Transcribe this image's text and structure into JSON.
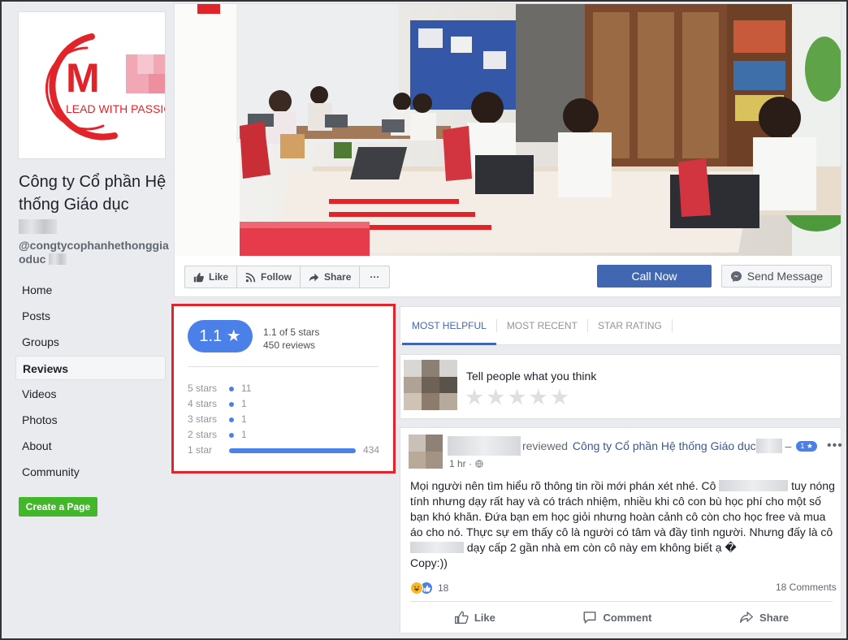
{
  "brand": {
    "logo_letter": "M",
    "logo_tagline": "LEAD WITH PASSIO",
    "accent_red": "#e0242a",
    "link_blue": "#4267b2",
    "rating_blue": "#4a80e8"
  },
  "page": {
    "name": "Công ty Cổ phần Hệ thống Giáo dục",
    "handle": "@congtycophanhethonggiaoduc"
  },
  "nav": [
    {
      "label": "Home",
      "active": false
    },
    {
      "label": "Posts",
      "active": false
    },
    {
      "label": "Groups",
      "active": false
    },
    {
      "label": "Reviews",
      "active": true
    },
    {
      "label": "Videos",
      "active": false
    },
    {
      "label": "Photos",
      "active": false
    },
    {
      "label": "About",
      "active": false
    },
    {
      "label": "Community",
      "active": false
    }
  ],
  "create_page_label": "Create a Page",
  "actions": {
    "like": "Like",
    "follow": "Follow",
    "share": "Share",
    "more": "···",
    "call_now": "Call Now",
    "send_message": "Send Message"
  },
  "rating": {
    "score_label": "1.1 ★",
    "summary": "1.1 of 5 stars",
    "reviews_count": "450 reviews",
    "distribution": [
      {
        "label": "5 stars",
        "count": "11",
        "fraction": 0.025
      },
      {
        "label": "4 stars",
        "count": "1",
        "fraction": 0.002
      },
      {
        "label": "3 stars",
        "count": "1",
        "fraction": 0.002
      },
      {
        "label": "2 stars",
        "count": "1",
        "fraction": 0.002
      },
      {
        "label": "1 star",
        "count": "434",
        "fraction": 1.0
      }
    ]
  },
  "tabs": [
    {
      "label": "MOST HELPFUL",
      "active": true
    },
    {
      "label": "MOST RECENT",
      "active": false
    },
    {
      "label": "STAR RATING",
      "active": false
    }
  ],
  "composer": {
    "prompt": "Tell people what you think",
    "star_glyph": "★"
  },
  "review": {
    "action_text": "reviewed",
    "page_name": "Công ty Cổ phần Hệ thống Giáo dục",
    "dash": "–",
    "star_badge": "1 ★",
    "time": "1 hr ·",
    "body": {
      "l1": "Mọi người nên tìm hiểu rõ thông tin rồi mới phán xét nhé. Cô",
      "l1b": "tuy nóng",
      "l2": "tính nhưng dạy rất hay và có trách nhiệm, nhiều khi cô con bù học phí cho một số",
      "l3": "bạn khó khăn. Đứa bạn em học giỏi nhưng hoàn cảnh cô còn cho học free và mua",
      "l4": "áo cho nó. Thực sự em thấy cô là người có tâm và đầy tình người. Nhưng đấy là cô",
      "l5": "dạy cấp 2 gần nhà em còn cô này em không biết ạ �",
      "l6": "Copy:))"
    },
    "reactions_count": "18",
    "comments_count": "18 Comments",
    "like": "Like",
    "comment": "Comment",
    "share": "Share"
  }
}
